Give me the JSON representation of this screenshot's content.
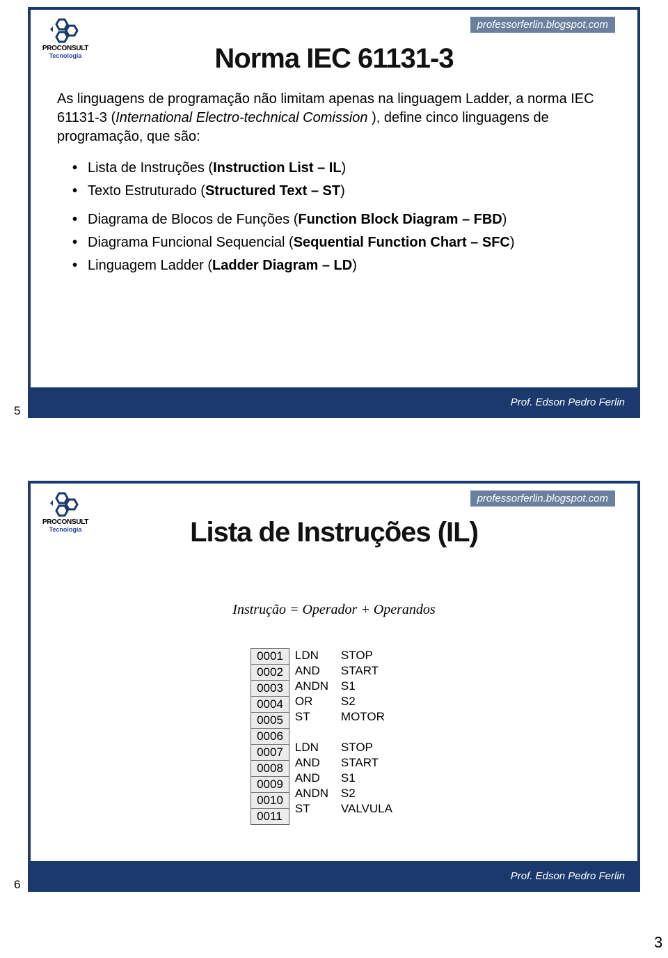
{
  "header_url": "professorferlin.blogspot.com",
  "logo": {
    "brand": "PROCONSULT",
    "sub": "Tecnologia"
  },
  "footer_credit": "Prof. Edson Pedro Ferlin",
  "page_number": "3",
  "slide1": {
    "num": "5",
    "title": "Norma IEC 61131-3",
    "para_leadin": "As linguagens de programação não limitam apenas na linguagem Ladder, a norma IEC 61131-3 (",
    "para_italic1": "International Electro-technical Comission ",
    "para_mid": "), define cinco linguagens de programação, que são:",
    "b1_pre": "Lista de Instruções (",
    "b1_bold": "Instruction List – IL",
    "b1_post": ")",
    "b2_pre": "Texto Estruturado (",
    "b2_bold": "Structured Text – ST",
    "b2_post": ")",
    "b3_pre": "Diagrama de Blocos de Funções (",
    "b3_bold": "Function Block Diagram – FBD",
    "b3_post": ")",
    "b4_pre": "Diagrama Funcional Sequencial (",
    "b4_bold": "Sequential Function Chart – SFC",
    "b4_post": ")",
    "b5_pre": "Linguagem Ladder (",
    "b5_bold": "Ladder Diagram – LD",
    "b5_post": ")"
  },
  "slide2": {
    "num": "6",
    "title": "Lista de Instruções (IL)",
    "formula": "Instrução = Operador + Operandos",
    "lines": [
      "0001",
      "0002",
      "0003",
      "0004",
      "0005",
      "0006",
      "0007",
      "0008",
      "0009",
      "0010",
      "0011"
    ],
    "code": [
      {
        "op": "LDN",
        "arg": "STOP"
      },
      {
        "op": "AND",
        "arg": "START"
      },
      {
        "op": "ANDN",
        "arg": "S1"
      },
      {
        "op": "OR",
        "arg": "S2"
      },
      {
        "op": "ST",
        "arg": "MOTOR"
      },
      {
        "op": "",
        "arg": ""
      },
      {
        "op": "LDN",
        "arg": "STOP"
      },
      {
        "op": "AND",
        "arg": "START"
      },
      {
        "op": "AND",
        "arg": "S1"
      },
      {
        "op": "ANDN",
        "arg": "S2"
      },
      {
        "op": "ST",
        "arg": "VALVULA"
      }
    ]
  }
}
